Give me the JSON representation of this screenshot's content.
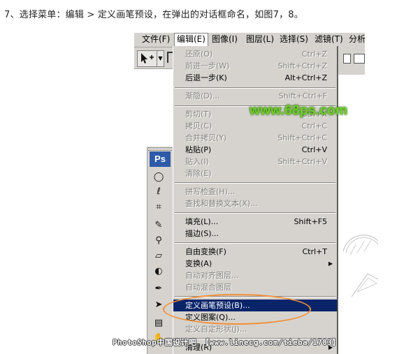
{
  "caption": "7、选择菜单：编辑 > 定义画笔预设，在弹出的对话框命名，如图7，8。",
  "menubar": {
    "items": [
      {
        "label": "文件(F)"
      },
      {
        "label": "编辑(E)",
        "active": true
      },
      {
        "label": "图像(I)"
      },
      {
        "label": "图层(L)"
      },
      {
        "label": "选择(S)"
      },
      {
        "label": "滤镜(T)"
      },
      {
        "label": "分析"
      }
    ]
  },
  "edit_menu": {
    "items": [
      {
        "label": "还原(O)",
        "shortcut": "Ctrl+Z",
        "enabled": false
      },
      {
        "label": "前进一步(W)",
        "shortcut": "Shift+Ctrl+Z",
        "enabled": false
      },
      {
        "label": "后退一步(K)",
        "shortcut": "Alt+Ctrl+Z",
        "enabled": true
      },
      {
        "label": "渐隐(D)...",
        "shortcut": "Shift+Ctrl+F",
        "enabled": false
      },
      {
        "label": "剪切(T)",
        "shortcut": "Ctrl+X",
        "enabled": false
      },
      {
        "label": "拷贝(C)",
        "shortcut": "Ctrl+C",
        "enabled": false
      },
      {
        "label": "合并拷贝(Y)",
        "shortcut": "Shift+Ctrl+C",
        "enabled": false
      },
      {
        "label": "粘贴(P)",
        "shortcut": "Ctrl+V",
        "enabled": true
      },
      {
        "label": "贴入(I)",
        "shortcut": "Shift+Ctrl+V",
        "enabled": false
      },
      {
        "label": "清除(E)",
        "shortcut": "",
        "enabled": false
      },
      {
        "label": "拼写检查(H)...",
        "shortcut": "",
        "enabled": false
      },
      {
        "label": "查找和替换文本(X)...",
        "shortcut": "",
        "enabled": false
      },
      {
        "label": "填充(L)...",
        "shortcut": "Shift+F5",
        "enabled": true
      },
      {
        "label": "描边(S)...",
        "shortcut": "",
        "enabled": true
      },
      {
        "label": "自由变换(F)",
        "shortcut": "Ctrl+T",
        "enabled": true
      },
      {
        "label": "变换(A)",
        "shortcut": "",
        "enabled": true,
        "submenu": true
      },
      {
        "label": "自动对齐图层...",
        "shortcut": "",
        "enabled": false
      },
      {
        "label": "自动混合图层",
        "shortcut": "",
        "enabled": false
      },
      {
        "label": "定义画笔预设(B)...",
        "shortcut": "",
        "enabled": true,
        "highlighted": true
      },
      {
        "label": "定义图案(Q)...",
        "shortcut": "",
        "enabled": true
      },
      {
        "label": "定义自定形状(J)...",
        "shortcut": "",
        "enabled": false
      },
      {
        "label": "清理(R)",
        "shortcut": "",
        "enabled": true,
        "submenu": true
      }
    ]
  },
  "toolbox": {
    "logo": "Ps",
    "icons": [
      "marquee-icon",
      "lasso-icon",
      "crop-icon",
      "healing-icon",
      "stamp-icon",
      "eraser-icon",
      "dodge-icon",
      "pen-icon",
      "selection-arrow-icon",
      "notes-icon",
      "hand-icon"
    ]
  },
  "watermarks": {
    "top": "www.68ps.com",
    "bottom": "PhotoShop中国设计吧 【www.linecg.com/tieba/1783】"
  },
  "colors": {
    "highlight": "#0a246a",
    "callout": "#f0913a",
    "menu_bg": "#d6d3ce",
    "watermark_green": "#6fcf2c"
  }
}
